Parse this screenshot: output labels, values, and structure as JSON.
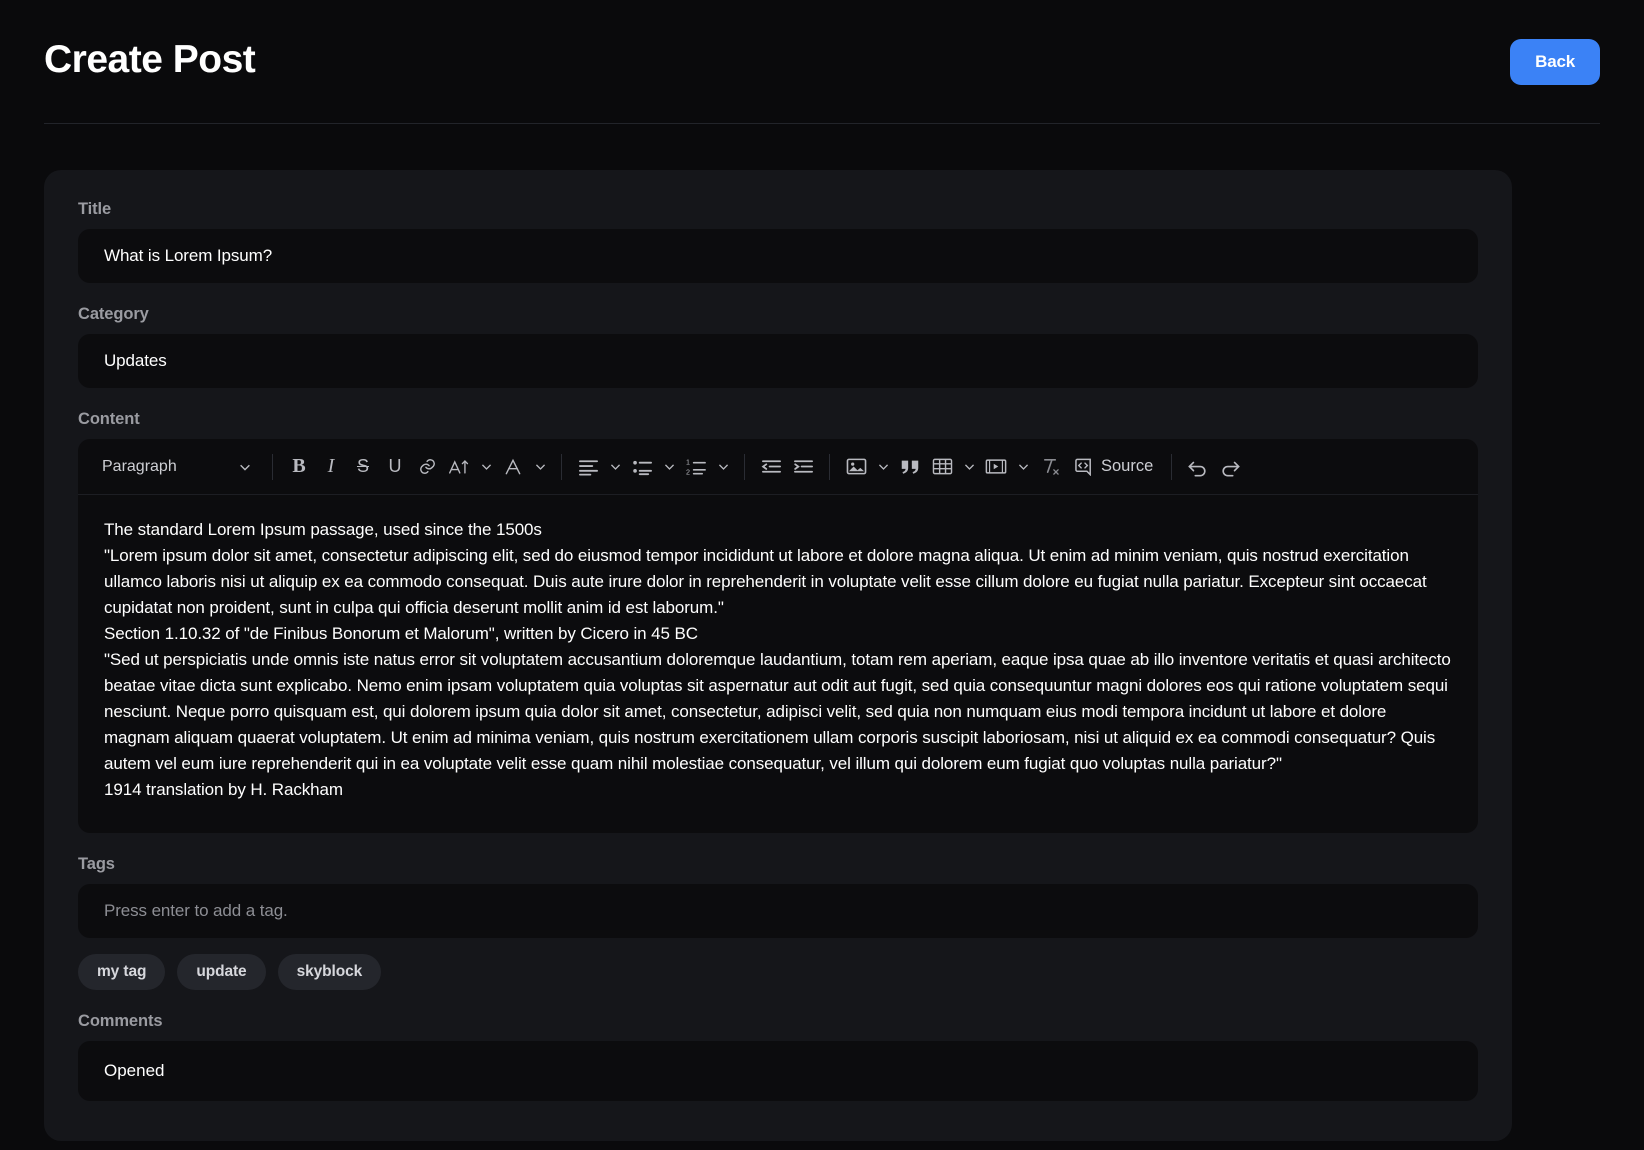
{
  "header": {
    "title": "Create Post",
    "back_label": "Back",
    "accent_color": "#3b82f6"
  },
  "form": {
    "title": {
      "label": "Title",
      "value": "What is Lorem Ipsum?"
    },
    "category": {
      "label": "Category",
      "value": "Updates"
    },
    "content": {
      "label": "Content",
      "toolbar": {
        "style_dropdown": "Paragraph",
        "source_label": "Source",
        "buttons": [
          "bold",
          "italic",
          "strikethrough",
          "underline",
          "link",
          "font-size",
          "font-color",
          "align",
          "bulleted-list",
          "numbered-list",
          "outdent",
          "indent",
          "image",
          "blockquote",
          "table",
          "media",
          "remove-format",
          "source",
          "undo",
          "redo"
        ]
      },
      "paragraphs": [
        "The standard Lorem Ipsum passage, used since the 1500s",
        "\"Lorem ipsum dolor sit amet, consectetur adipiscing elit, sed do eiusmod tempor incididunt ut labore et dolore magna aliqua. Ut enim ad minim veniam, quis nostrud exercitation ullamco laboris nisi ut aliquip ex ea commodo consequat. Duis aute irure dolor in reprehenderit in voluptate velit esse cillum dolore eu fugiat nulla pariatur. Excepteur sint occaecat cupidatat non proident, sunt in culpa qui officia deserunt mollit anim id est laborum.\"",
        "Section 1.10.32 of \"de Finibus Bonorum et Malorum\", written by Cicero in 45 BC",
        "\"Sed ut perspiciatis unde omnis iste natus error sit voluptatem accusantium doloremque laudantium, totam rem aperiam, eaque ipsa quae ab illo inventore veritatis et quasi architecto beatae vitae dicta sunt explicabo. Nemo enim ipsam voluptatem quia voluptas sit aspernatur aut odit aut fugit, sed quia consequuntur magni dolores eos qui ratione voluptatem sequi nesciunt. Neque porro quisquam est, qui dolorem ipsum quia dolor sit amet, consectetur, adipisci velit, sed quia non numquam eius modi tempora incidunt ut labore et dolore magnam aliquam quaerat voluptatem. Ut enim ad minima veniam, quis nostrum exercitationem ullam corporis suscipit laboriosam, nisi ut aliquid ex ea commodi consequatur? Quis autem vel eum iure reprehenderit qui in ea voluptate velit esse quam nihil molestiae consequatur, vel illum qui dolorem eum fugiat quo voluptas nulla pariatur?\"",
        "1914 translation by H. Rackham"
      ]
    },
    "tags": {
      "label": "Tags",
      "placeholder": "Press enter to add a tag.",
      "items": [
        "my tag",
        "update",
        "skyblock"
      ]
    },
    "comments": {
      "label": "Comments",
      "value": "Opened"
    }
  }
}
